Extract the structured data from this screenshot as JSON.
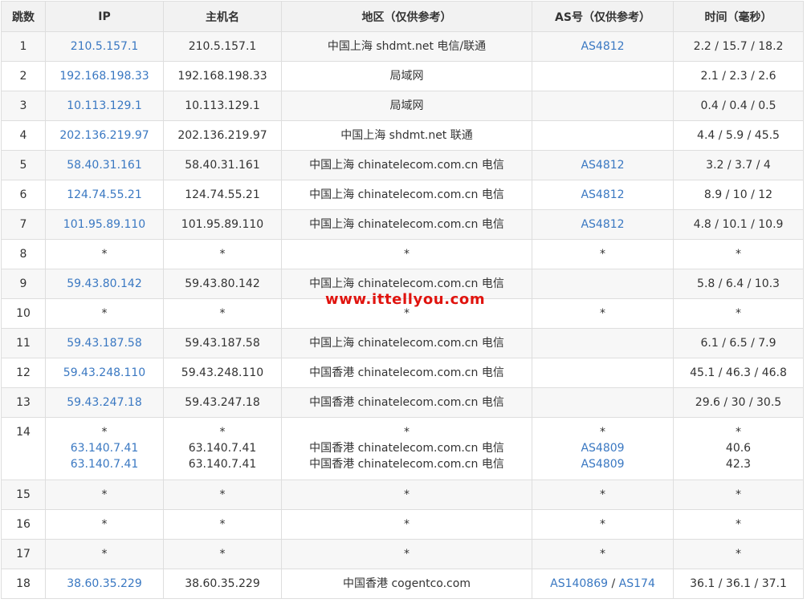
{
  "headers": [
    "跳数",
    "IP",
    "主机名",
    "地区（仅供参考）",
    "AS号（仅供参考）",
    "时间（毫秒）"
  ],
  "watermark": "www.ittellyou.com",
  "link_color": "#3a78c2",
  "rows": [
    {
      "hop": "1",
      "ip": [
        "210.5.157.1"
      ],
      "host": [
        "210.5.157.1"
      ],
      "region": [
        "中国上海 shdmt.net 电信/联通"
      ],
      "asn": [
        [
          "AS4812"
        ]
      ],
      "time": [
        "2.2 / 15.7 / 18.2"
      ]
    },
    {
      "hop": "2",
      "ip": [
        "192.168.198.33"
      ],
      "host": [
        "192.168.198.33"
      ],
      "region": [
        "局域网"
      ],
      "asn": [
        []
      ],
      "time": [
        "2.1 / 2.3 / 2.6"
      ]
    },
    {
      "hop": "3",
      "ip": [
        "10.113.129.1"
      ],
      "host": [
        "10.113.129.1"
      ],
      "region": [
        "局域网"
      ],
      "asn": [
        []
      ],
      "time": [
        "0.4 / 0.4 / 0.5"
      ]
    },
    {
      "hop": "4",
      "ip": [
        "202.136.219.97"
      ],
      "host": [
        "202.136.219.97"
      ],
      "region": [
        "中国上海 shdmt.net 联通"
      ],
      "asn": [
        []
      ],
      "time": [
        "4.4 / 5.9 / 45.5"
      ]
    },
    {
      "hop": "5",
      "ip": [
        "58.40.31.161"
      ],
      "host": [
        "58.40.31.161"
      ],
      "region": [
        "中国上海 chinatelecom.com.cn 电信"
      ],
      "asn": [
        [
          "AS4812"
        ]
      ],
      "time": [
        "3.2 / 3.7 / 4"
      ]
    },
    {
      "hop": "6",
      "ip": [
        "124.74.55.21"
      ],
      "host": [
        "124.74.55.21"
      ],
      "region": [
        "中国上海 chinatelecom.com.cn 电信"
      ],
      "asn": [
        [
          "AS4812"
        ]
      ],
      "time": [
        "8.9 / 10 / 12"
      ]
    },
    {
      "hop": "7",
      "ip": [
        "101.95.89.110"
      ],
      "host": [
        "101.95.89.110"
      ],
      "region": [
        "中国上海 chinatelecom.com.cn 电信"
      ],
      "asn": [
        [
          "AS4812"
        ]
      ],
      "time": [
        "4.8 / 10.1 / 10.9"
      ]
    },
    {
      "hop": "8",
      "ip": [
        "*"
      ],
      "host": [
        "*"
      ],
      "region": [
        "*"
      ],
      "asn": [
        [
          "*"
        ]
      ],
      "time": [
        "*"
      ]
    },
    {
      "hop": "9",
      "ip": [
        "59.43.80.142"
      ],
      "host": [
        "59.43.80.142"
      ],
      "region": [
        "中国上海 chinatelecom.com.cn 电信"
      ],
      "asn": [
        []
      ],
      "time": [
        "5.8 / 6.4 / 10.3"
      ]
    },
    {
      "hop": "10",
      "ip": [
        "*"
      ],
      "host": [
        "*"
      ],
      "region": [
        "*"
      ],
      "asn": [
        [
          "*"
        ]
      ],
      "time": [
        "*"
      ]
    },
    {
      "hop": "11",
      "ip": [
        "59.43.187.58"
      ],
      "host": [
        "59.43.187.58"
      ],
      "region": [
        "中国上海 chinatelecom.com.cn 电信"
      ],
      "asn": [
        []
      ],
      "time": [
        "6.1 / 6.5 / 7.9"
      ]
    },
    {
      "hop": "12",
      "ip": [
        "59.43.248.110"
      ],
      "host": [
        "59.43.248.110"
      ],
      "region": [
        "中国香港 chinatelecom.com.cn 电信"
      ],
      "asn": [
        []
      ],
      "time": [
        "45.1 / 46.3 / 46.8"
      ]
    },
    {
      "hop": "13",
      "ip": [
        "59.43.247.18"
      ],
      "host": [
        "59.43.247.18"
      ],
      "region": [
        "中国香港 chinatelecom.com.cn 电信"
      ],
      "asn": [
        []
      ],
      "time": [
        "29.6 / 30 / 30.5"
      ]
    },
    {
      "hop": "14",
      "ip": [
        "*",
        "63.140.7.41",
        "63.140.7.41"
      ],
      "host": [
        "*",
        "63.140.7.41",
        "63.140.7.41"
      ],
      "region": [
        "*",
        "中国香港 chinatelecom.com.cn 电信",
        "中国香港 chinatelecom.com.cn 电信"
      ],
      "asn": [
        [
          "*"
        ],
        [
          "AS4809"
        ],
        [
          "AS4809"
        ]
      ],
      "time": [
        "*",
        "40.6",
        "42.3"
      ]
    },
    {
      "hop": "15",
      "ip": [
        "*"
      ],
      "host": [
        "*"
      ],
      "region": [
        "*"
      ],
      "asn": [
        [
          "*"
        ]
      ],
      "time": [
        "*"
      ]
    },
    {
      "hop": "16",
      "ip": [
        "*"
      ],
      "host": [
        "*"
      ],
      "region": [
        "*"
      ],
      "asn": [
        [
          "*"
        ]
      ],
      "time": [
        "*"
      ]
    },
    {
      "hop": "17",
      "ip": [
        "*"
      ],
      "host": [
        "*"
      ],
      "region": [
        "*"
      ],
      "asn": [
        [
          "*"
        ]
      ],
      "time": [
        "*"
      ]
    },
    {
      "hop": "18",
      "ip": [
        "38.60.35.229"
      ],
      "host": [
        "38.60.35.229"
      ],
      "region": [
        "中国香港 cogentco.com"
      ],
      "asn": [
        [
          "AS140869",
          "AS174"
        ]
      ],
      "time": [
        "36.1 / 36.1 / 37.1"
      ]
    }
  ]
}
